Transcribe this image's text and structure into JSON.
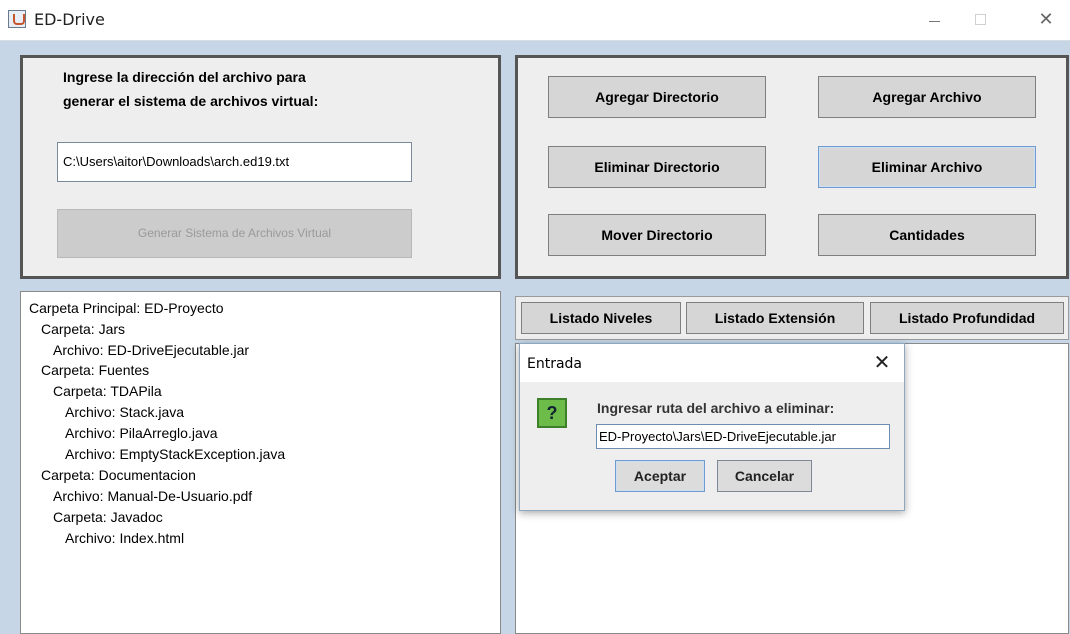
{
  "window": {
    "title": "ED-Drive"
  },
  "left_panel": {
    "prompt_line1": "Ingrese la dirección del archivo para",
    "prompt_line2": "generar el sistema de archivos virtual:",
    "path_value": "C:\\Users\\aitor\\Downloads\\arch.ed19.txt",
    "generate_button": "Generar Sistema de Archivos Virtual"
  },
  "actions": {
    "add_directory": "Agregar Directorio",
    "add_file": "Agregar Archivo",
    "delete_directory": "Eliminar Directorio",
    "delete_file": "Eliminar Archivo",
    "move_directory": "Mover Directorio",
    "counts": "Cantidades"
  },
  "tree": {
    "lines": [
      "Carpeta Principal: ED-Proyecto",
      "Carpeta: Jars",
      "Archivo: ED-DriveEjecutable.jar",
      "Carpeta: Fuentes",
      "Carpeta: TDAPila",
      "Archivo: Stack.java",
      "Archivo: PilaArreglo.java",
      "Archivo: EmptyStackException.java",
      "Carpeta: Documentacion",
      "Archivo: Manual-De-Usuario.pdf",
      "Carpeta: Javadoc",
      "Archivo: Index.html"
    ]
  },
  "listing": {
    "levels": "Listado Niveles",
    "extension": "Listado Extensión",
    "depth": "Listado Profundidad"
  },
  "dialog": {
    "title": "Entrada",
    "message": "Ingresar ruta del archivo a eliminar:",
    "input_value": "ED-Proyecto\\Jars\\ED-DriveEjecutable.jar",
    "icon_glyph": "?",
    "ok": "Aceptar",
    "cancel": "Cancelar"
  },
  "colors": {
    "background": "#c6d6e6",
    "panel": "#eeeeee",
    "button": "#d6d6d6",
    "focus_border": "#6f9bd1",
    "question_icon": "#6dbb49"
  }
}
